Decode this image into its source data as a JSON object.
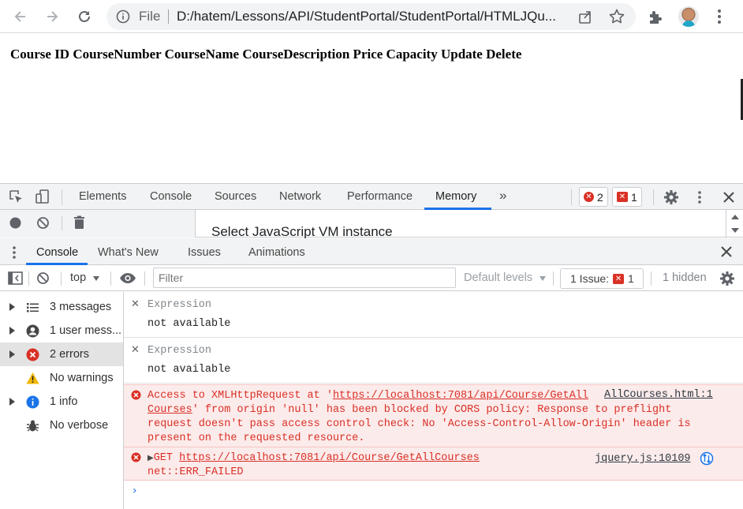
{
  "browser": {
    "site_label": "File",
    "url": "D:/hatem/Lessons/API/StudentPortal/StudentPortal/HTMLJQu..."
  },
  "page": {
    "table_headers": "Course ID CourseNumber CourseName CourseDescription Price Capacity Update Delete"
  },
  "devtools": {
    "tabs": [
      "Elements",
      "Console",
      "Sources",
      "Network",
      "Performance",
      "Memory"
    ],
    "active_tab": "Memory",
    "more_tabs": "»",
    "error_count": "2",
    "issue_count": "1",
    "memory_title": "Select JavaScript VM instance",
    "drawer_tabs": [
      "Console",
      "What's New",
      "Issues",
      "Animations"
    ],
    "console_toolbar": {
      "context": "top",
      "filter_placeholder": "Filter",
      "levels": "Default levels",
      "issues_label": "1 Issue:",
      "issues_count": "1",
      "hidden": "1 hidden"
    },
    "sidebar": [
      {
        "label": "3 messages",
        "icon": "list-icon"
      },
      {
        "label": "1 user mess...",
        "icon": "user-icon"
      },
      {
        "label": "2 errors",
        "icon": "error-icon"
      },
      {
        "label": "No warnings",
        "icon": "warning-icon"
      },
      {
        "label": "1 info",
        "icon": "info-icon"
      },
      {
        "label": "No verbose",
        "icon": "bug-icon"
      }
    ],
    "watches": [
      {
        "expression": "Expression",
        "value": "not available"
      },
      {
        "expression": "Expression",
        "value": "not available"
      }
    ],
    "errors": {
      "cors_prefix": "Access to XMLHttpRequest at '",
      "cors_url": "https://localhost:7081/api/Course/GetAll",
      "cors_url_cont": "Courses",
      "cors_line2_rest": "' from origin 'null' has been blocked by CORS policy: Response to preflight",
      "cors_line3": "request doesn't pass access control check: No 'Access-Control-Allow-Origin' header is",
      "cors_line4": "present on the requested resource.",
      "cors_source": "AllCourses.html:1",
      "get_method": "GET",
      "get_url": "https://localhost:7081/api/Course/GetAllCourses",
      "get_error": "net::ERR_FAILED",
      "get_source": "jquery.js:10109"
    },
    "prompt": "›"
  }
}
